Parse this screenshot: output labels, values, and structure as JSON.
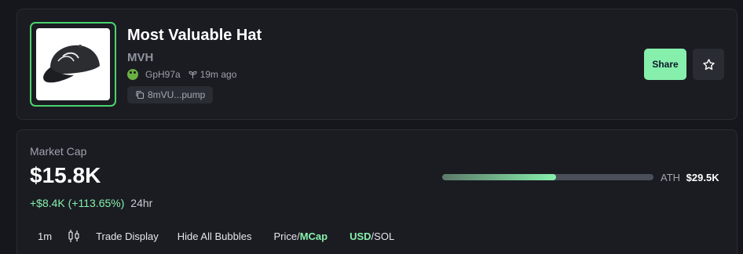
{
  "token": {
    "name": "Most Valuable Hat",
    "ticker": "MVH",
    "creator": "GpH97a",
    "age": "19m ago",
    "contract_short": "8mVU...pump",
    "image_icon": "cap-icon"
  },
  "actions": {
    "share_label": "Share",
    "favorite_icon": "star-icon"
  },
  "market": {
    "label": "Market Cap",
    "value": "$15.8K",
    "change": "+$8.4K (+113.65%)",
    "period": "24hr",
    "ath_label": "ATH",
    "ath_value": "$29.5K",
    "ath_progress": 0.54
  },
  "toolbar": {
    "interval": "1m",
    "candles_icon": "candlestick-icon",
    "trade_display": "Trade Display",
    "hide_bubbles": "Hide All Bubbles",
    "price_label": "Price",
    "mcap_label": "MCap",
    "usd_label": "USD",
    "sol_label": "SOL",
    "slash": "/"
  },
  "colors": {
    "accent": "#86efac",
    "frame": "#4cd36c",
    "card": "#1b1c22",
    "background": "#16171c"
  }
}
